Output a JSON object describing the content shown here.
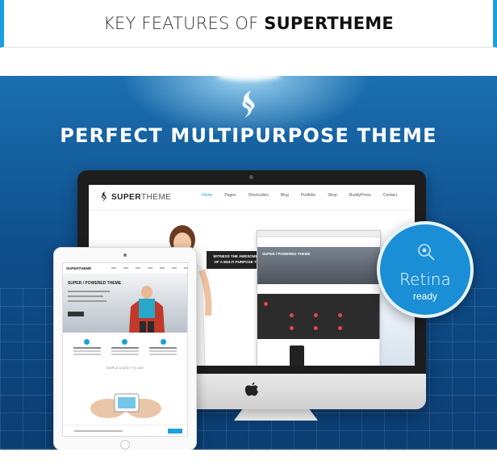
{
  "header": {
    "title_light": "KEY FEATURES OF ",
    "title_bold": "SUPERTHEME"
  },
  "hero": {
    "title": "PERFECT MULTIPURPOSE THEME"
  },
  "monitor_screen": {
    "brand_bold": "SUPER",
    "brand_light": "THEME",
    "menu": [
      "Home",
      "Pages",
      "Shortcodes",
      "Blog",
      "Portfolio",
      "Shop",
      "BuddyPress",
      "Contact"
    ],
    "callout": "WITNESS THE AWESOMENESS OF A MULTI PURPOSE THEME",
    "browser_hero_text": "SUPER / POWERED THEME"
  },
  "retina_badge": {
    "title": "Retina",
    "subtitle": "ready",
    "icon": "retina-icon"
  },
  "ipad_screen": {
    "brand": "SUPERTHEME",
    "hero_title": "SUPER / POWERED THEME",
    "section_label": "SIMPLE & EASY TO USE"
  },
  "colors": {
    "accent": "#1aa0dc",
    "hero_top": "#1b6fb0",
    "hero_bottom": "#0b3d72",
    "badge": "#1a8fd6"
  }
}
